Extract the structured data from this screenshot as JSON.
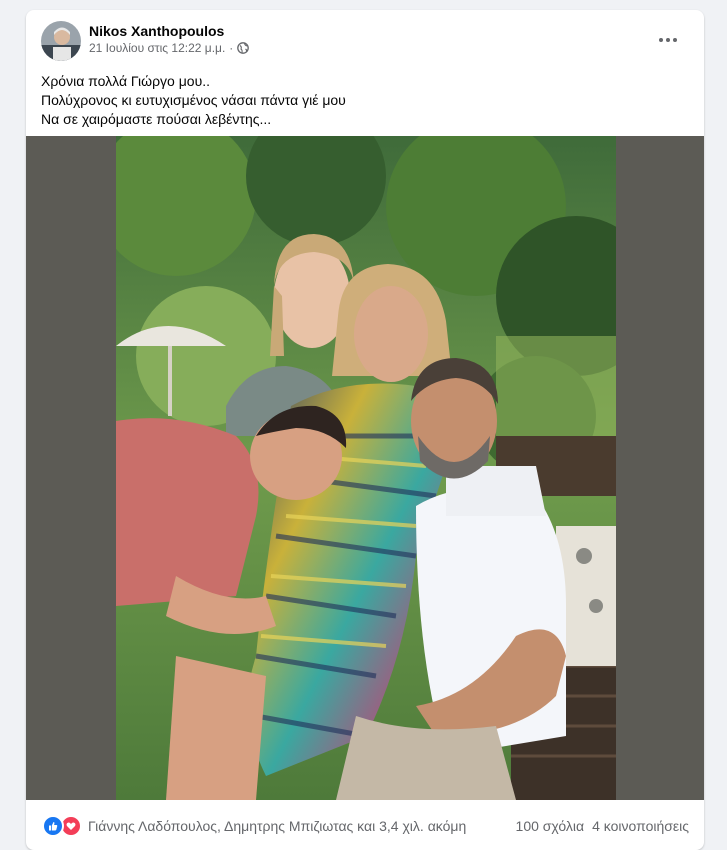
{
  "post": {
    "author": "Nikos Xanthopoulos",
    "timestamp": "21 Ιουλίου στις 12:22 μ.μ.",
    "separator": "·",
    "privacy_icon": "globe-icon",
    "menu_icon": "more-options-icon",
    "text_lines": [
      "Χρόνια πολλά Γιώργο μου..",
      "Πολύχρονος κι ευτυχισμένος νάσαι πάντα γιέ μου",
      "Να σε χαιρόμαστε πούσαι λεβέντης..."
    ]
  },
  "footer": {
    "reaction_icons": [
      "like-icon",
      "love-icon"
    ],
    "reactors": "Γιάννης Λαδόπουλος, Δημητρης Μπιζιωτας και 3,4 χιλ. ακόμη",
    "comments": "100 σχόλια",
    "shares": "4 κοινοποιήσεις"
  },
  "colors": {
    "background": "#f0f2f5",
    "card": "#ffffff",
    "secondary_text": "#65676b",
    "like_blue": "#1877f2",
    "love_red": "#f33e58",
    "photo_matte": "#5c5b55"
  }
}
